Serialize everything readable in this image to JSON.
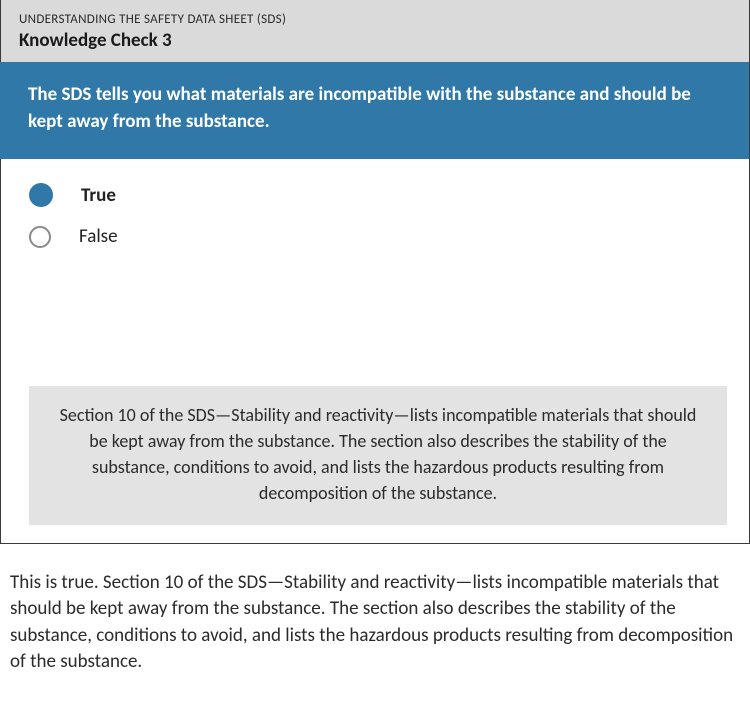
{
  "header": {
    "eyebrow": "UNDERSTANDING THE SAFETY DATA SHEET (SDS)",
    "title": "Knowledge Check 3"
  },
  "question": "The SDS tells you what materials are incompatible with the substance and should be kept away from the substance.",
  "answers": [
    {
      "label": "True",
      "selected": true
    },
    {
      "label": "False",
      "selected": false
    }
  ],
  "feedback": "Section 10 of the SDS—Stability and reactivity—lists incompatible materials that should be kept away from the substance. The section also describes the stability of the substance, conditions to avoid, and lists the hazardous products resulting from decomposition of the substance.",
  "explanation": "This is true. Section 10 of the SDS—Stability and reactivity—lists incompatible materials that should be kept away from the substance. The section also describes the stability of the substance, conditions to avoid, and lists the hazardous products resulting from decomposition of the substance."
}
